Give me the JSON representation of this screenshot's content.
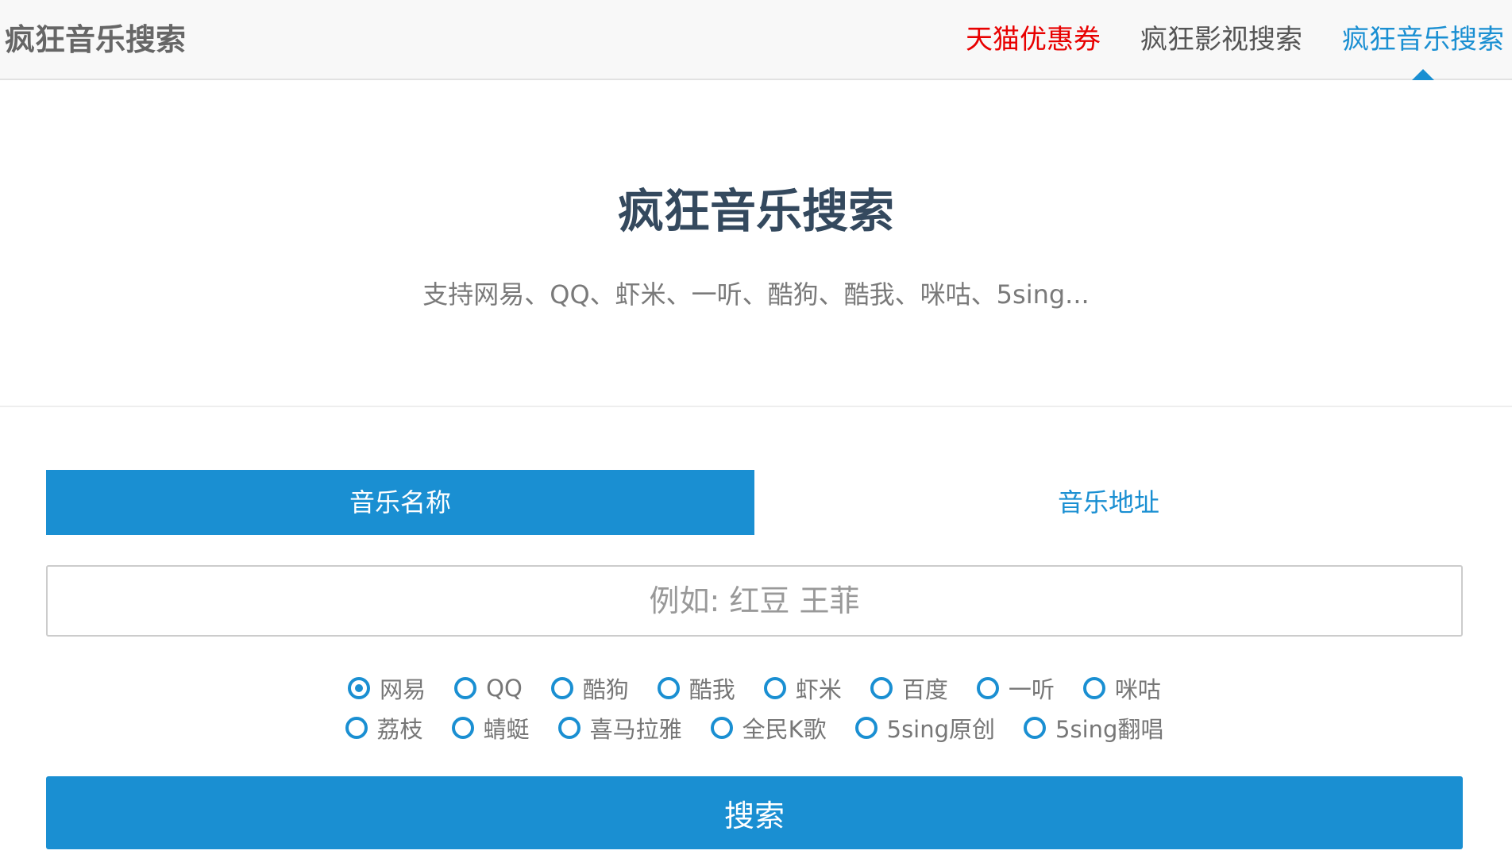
{
  "navbar": {
    "brand": "疯狂音乐搜索",
    "links": [
      {
        "label": "天猫优惠券"
      },
      {
        "label": "疯狂影视搜索"
      },
      {
        "label": "疯狂音乐搜索"
      }
    ]
  },
  "hero": {
    "title": "疯狂音乐搜索",
    "subtitle": "支持网易、QQ、虾米、一听、酷狗、酷我、咪咕、5sing..."
  },
  "form": {
    "tabs": [
      {
        "label": "音乐名称"
      },
      {
        "label": "音乐地址"
      }
    ],
    "input": {
      "placeholder": "例如: 红豆 王菲",
      "value": ""
    },
    "sources_row1": [
      "网易",
      "QQ",
      "酷狗",
      "酷我",
      "虾米",
      "百度",
      "一听",
      "咪咕"
    ],
    "sources_row2": [
      "荔枝",
      "蜻蜓",
      "喜马拉雅",
      "全民K歌",
      "5sing原创",
      "5sing翻唱"
    ],
    "selected_source": "网易",
    "submit_label": "搜索"
  },
  "colors": {
    "accent": "#1a8fd2",
    "promo": "#e80000",
    "title": "#34495e"
  }
}
